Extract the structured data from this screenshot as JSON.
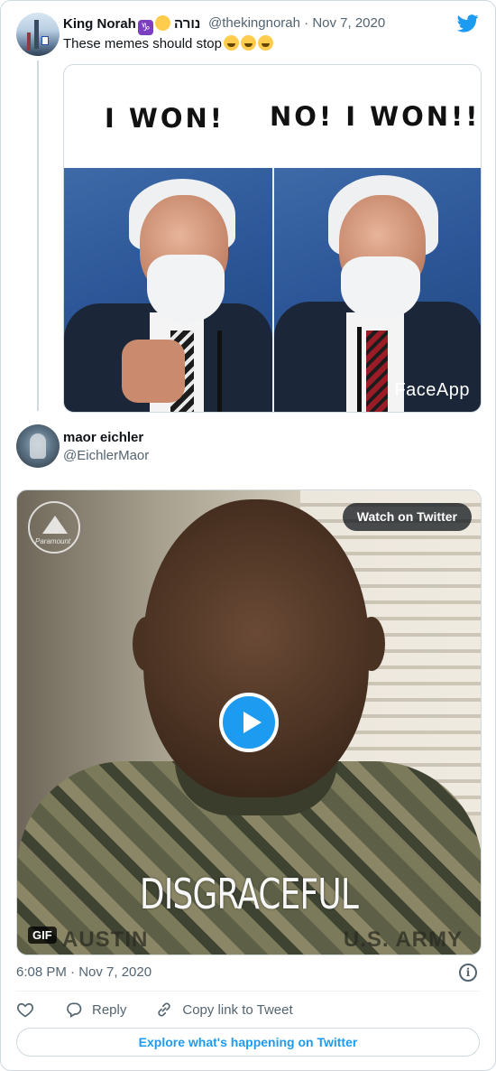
{
  "colors": {
    "accent": "#1d9bf0",
    "secondary_text": "#536471",
    "border": "#cfd9de"
  },
  "quoted_tweet": {
    "author_name": "King Norah",
    "name_suffix": "נורה",
    "name_emoji": [
      "capricorn-emoji",
      "relieved-face-emoji"
    ],
    "handle": "@thekingnorah",
    "separator": "·",
    "date": "Nov 7, 2020",
    "text": "These memes should stop",
    "text_emoji": [
      "face-with-tears-of-joy-emoji",
      "face-with-tears-of-joy-emoji",
      "face-with-tears-of-joy-emoji"
    ],
    "media": {
      "caption_left": "I WON!",
      "caption_right": "NO! I WON!!",
      "watermark": "FaceApp"
    }
  },
  "tweet": {
    "author_name": "maor eichler",
    "handle": "@EichlerMaor",
    "media": {
      "watch_label": "Watch on Twitter",
      "gif_label": "GIF",
      "video_caption": "DISGRACEFUL",
      "nametape_left": "AUSTIN",
      "nametape_right": "U.S. ARMY",
      "logo_text": "Paramount"
    },
    "time": "6:08 PM · Nov 7, 2020"
  },
  "actions": {
    "reply_label": "Reply",
    "copy_label": "Copy link to Tweet"
  },
  "explore_label": "Explore what's happening on Twitter"
}
